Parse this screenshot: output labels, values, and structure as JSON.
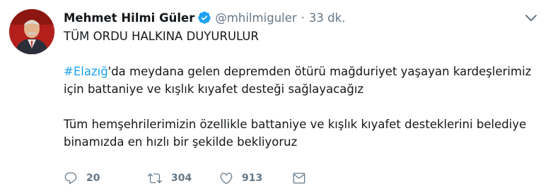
{
  "tweet": {
    "display_name": "Mehmet Hilmi Güler",
    "handle": "@mhilmiguler",
    "separator": "·",
    "time": "33 dk.",
    "line_1": "TÜM ORDU HALKINA DUYURULUR",
    "hashtag": "#Elazığ",
    "line_2_rest": "'da meydana gelen depremden ötürü mağduriyet yaşayan kardeşlerimiz",
    "line_3": "için battaniye ve kışlık kıyafet desteği sağlayacağız",
    "line_4": "Tüm hemşehrilerimizin özellikle battaniye ve kışlık kıyafet desteklerini belediye",
    "line_5": "binamızda en hızlı bir şekilde bekliyoruz"
  },
  "actions": {
    "reply_count": "20",
    "retweet_count": "304",
    "like_count": "913"
  },
  "icons": {
    "verified": "verified-badge-icon",
    "caret": "chevron-down-icon",
    "reply": "reply-icon",
    "retweet": "retweet-icon",
    "like": "heart-icon",
    "dm": "envelope-icon"
  },
  "colors": {
    "link": "#1da1f2",
    "secondary": "#657786",
    "text": "#14171a"
  }
}
